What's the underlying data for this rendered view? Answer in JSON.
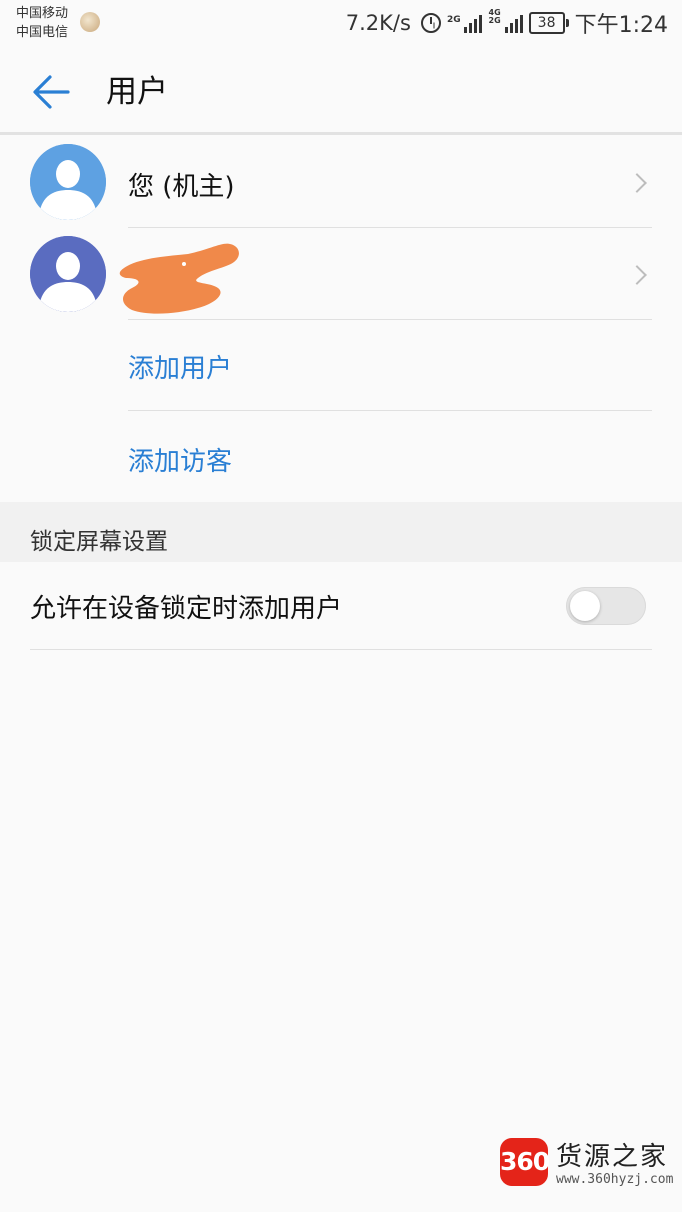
{
  "status_bar": {
    "carrier_1": "中国移动",
    "carrier_2": "中国电信",
    "net_speed": "7.2K/s",
    "signal_1_tag": "2G",
    "signal_2_tag": "4G 2G",
    "battery": "38",
    "time": "下午1:24"
  },
  "app_bar": {
    "title": "用户"
  },
  "users": [
    {
      "label": "您 (机主)",
      "avatar_color": "#5ea1e2"
    },
    {
      "label": "",
      "avatar_color": "#5a6cc0"
    }
  ],
  "actions": {
    "add_user": "添加用户",
    "add_guest": "添加访客"
  },
  "lock_screen": {
    "section_title": "锁定屏幕设置",
    "allow_add_users_label": "允许在设备锁定时添加用户",
    "allow_add_users_enabled": false
  },
  "watermark": {
    "badge": "360",
    "title": "货源之家",
    "url": "www.360hyzj.com"
  },
  "colors": {
    "accent": "#2a7fd4",
    "redaction": "#f0894a"
  }
}
